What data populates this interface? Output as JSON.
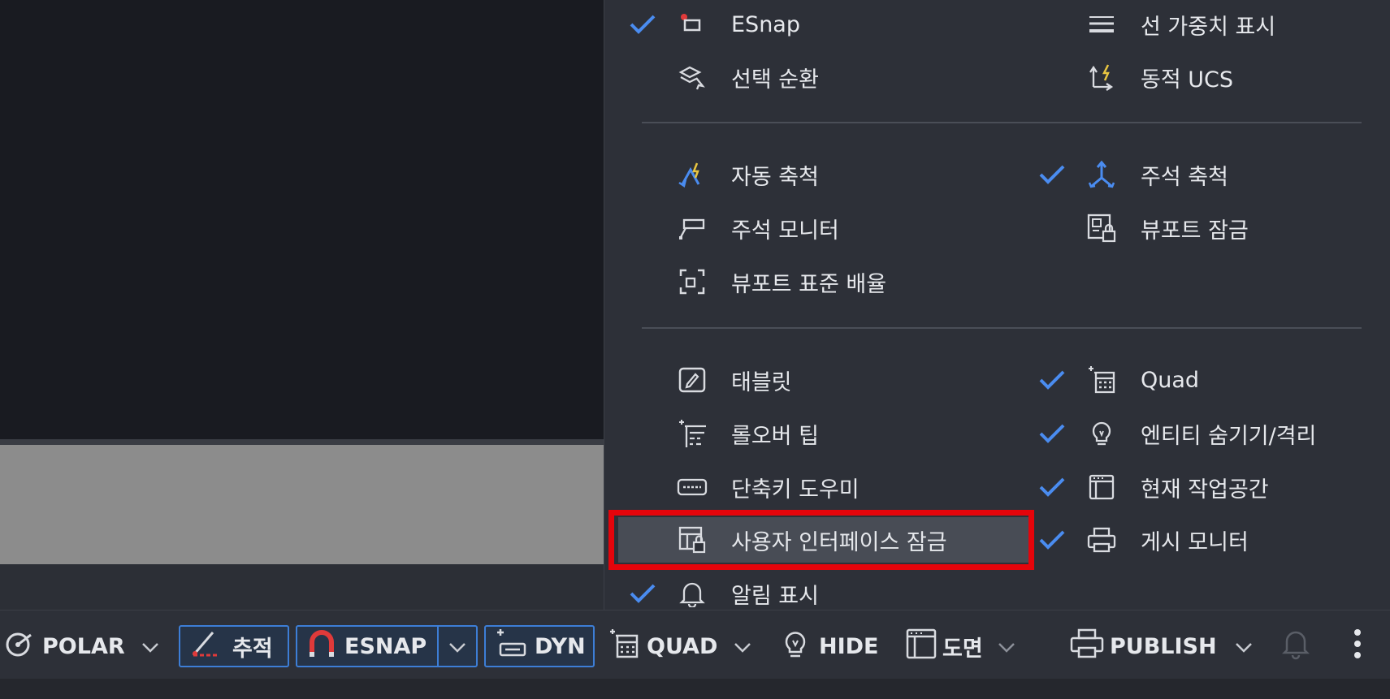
{
  "menu": {
    "left_column": [
      {
        "label": "ESnap",
        "checked": true,
        "icon": "esnap-icon"
      },
      {
        "label": "선택 순환",
        "checked": false,
        "icon": "selection-cycling-icon"
      },
      {
        "label": "자동 축척",
        "checked": false,
        "icon": "auto-scale-icon"
      },
      {
        "label": "주석 모니터",
        "checked": false,
        "icon": "annotation-monitor-icon"
      },
      {
        "label": "뷰포트 표준 배율",
        "checked": false,
        "icon": "viewport-scale-icon"
      },
      {
        "label": "태블릿",
        "checked": false,
        "icon": "tablet-icon"
      },
      {
        "label": "롤오버 팁",
        "checked": false,
        "icon": "rollover-tip-icon"
      },
      {
        "label": "단축키 도우미",
        "checked": false,
        "icon": "shortcut-helper-icon"
      },
      {
        "label": "사용자 인터페이스 잠금",
        "checked": false,
        "icon": "ui-lock-icon",
        "highlighted": true
      },
      {
        "label": "알림 표시",
        "checked": true,
        "icon": "bell-icon"
      }
    ],
    "right_column": [
      {
        "label": "선 가중치 표시",
        "checked": false,
        "icon": "lineweight-icon"
      },
      {
        "label": "동적 UCS",
        "checked": false,
        "icon": "dynamic-ucs-icon"
      },
      {
        "label": "주석 축척",
        "checked": true,
        "icon": "annotation-scale-icon"
      },
      {
        "label": "뷰포트 잠금",
        "checked": false,
        "icon": "viewport-lock-icon"
      },
      {
        "label": "Quad",
        "checked": true,
        "icon": "quad-icon"
      },
      {
        "label": "엔티티 숨기기/격리",
        "checked": true,
        "icon": "lightbulb-icon"
      },
      {
        "label": "현재 작업공간",
        "checked": true,
        "icon": "workspace-icon"
      },
      {
        "label": "게시 모니터",
        "checked": true,
        "icon": "publish-monitor-icon"
      }
    ]
  },
  "statusbar": {
    "polar": "POLAR",
    "tracking": "추적",
    "esnap": "ESNAP",
    "dyn": "DYN",
    "quad": "QUAD",
    "hide": "HIDE",
    "layout": "도면",
    "publish": "PUBLISH"
  },
  "colors": {
    "accent": "#4a8cf0",
    "highlight_box": "#e5040b",
    "menu_bg": "#2d3038"
  }
}
